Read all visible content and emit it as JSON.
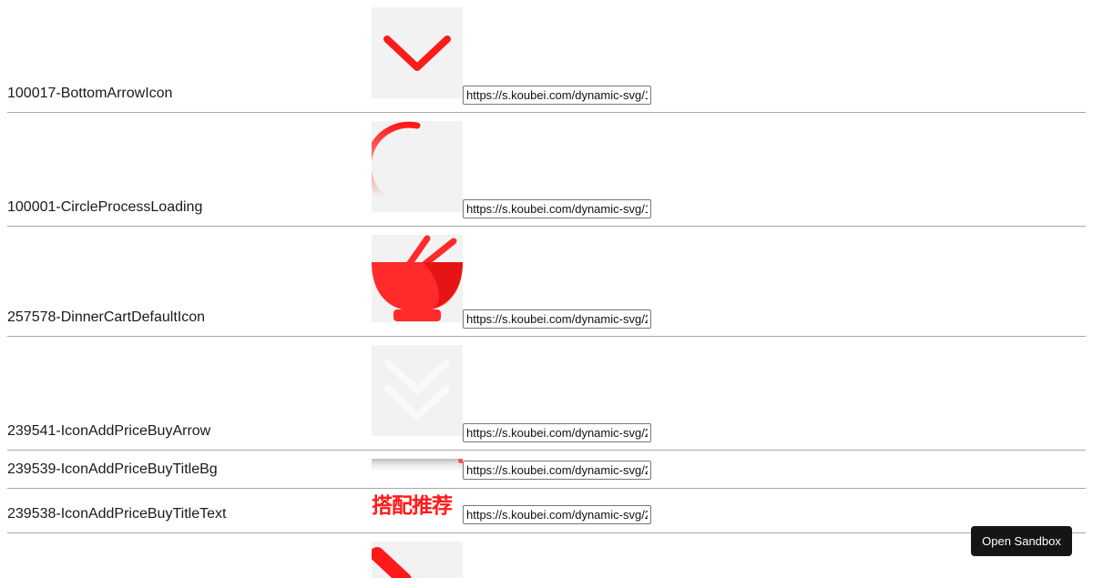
{
  "icons": [
    {
      "name": "100017-BottomArrowIcon",
      "url": "https://s.koubei.com/dynamic-svg/100017-BottomArrowIcon.svg",
      "icon": "chevron-down-icon"
    },
    {
      "name": "100001-CircleProcessLoading",
      "url": "https://s.koubei.com/dynamic-svg/100001-CircleProcessLoading.svg",
      "icon": "circle-loading-icon"
    },
    {
      "name": "257578-DinnerCartDefaultIcon",
      "url": "https://s.koubei.com/dynamic-svg/257578-DinnerCartDefaultIcon.svg",
      "icon": "bowl-chopsticks-icon"
    },
    {
      "name": "239541-IconAddPriceBuyArrow",
      "url": "https://s.koubei.com/dynamic-svg/239541-IconAddPriceBuyArrow.svg",
      "icon": "double-chevron-down-icon"
    },
    {
      "name": "239539-IconAddPriceBuyTitleBg",
      "url": "https://s.koubei.com/dynamic-svg/239539-IconAddPriceBuyTitleBg.svg",
      "icon": "title-bg-icon"
    },
    {
      "name": "239538-IconAddPriceBuyTitleText",
      "url": "https://s.koubei.com/dynamic-svg/239538-IconAddPriceBuyTitleText.svg",
      "icon": "title-text-icon",
      "glyph_text": "搭配推荐"
    }
  ],
  "sandbox_button": "Open Sandbox",
  "colors": {
    "accent": "#ff1a1a",
    "thumb_bg": "#f2f2f2",
    "divider": "#a8a8a8",
    "button_bg": "#151515"
  }
}
